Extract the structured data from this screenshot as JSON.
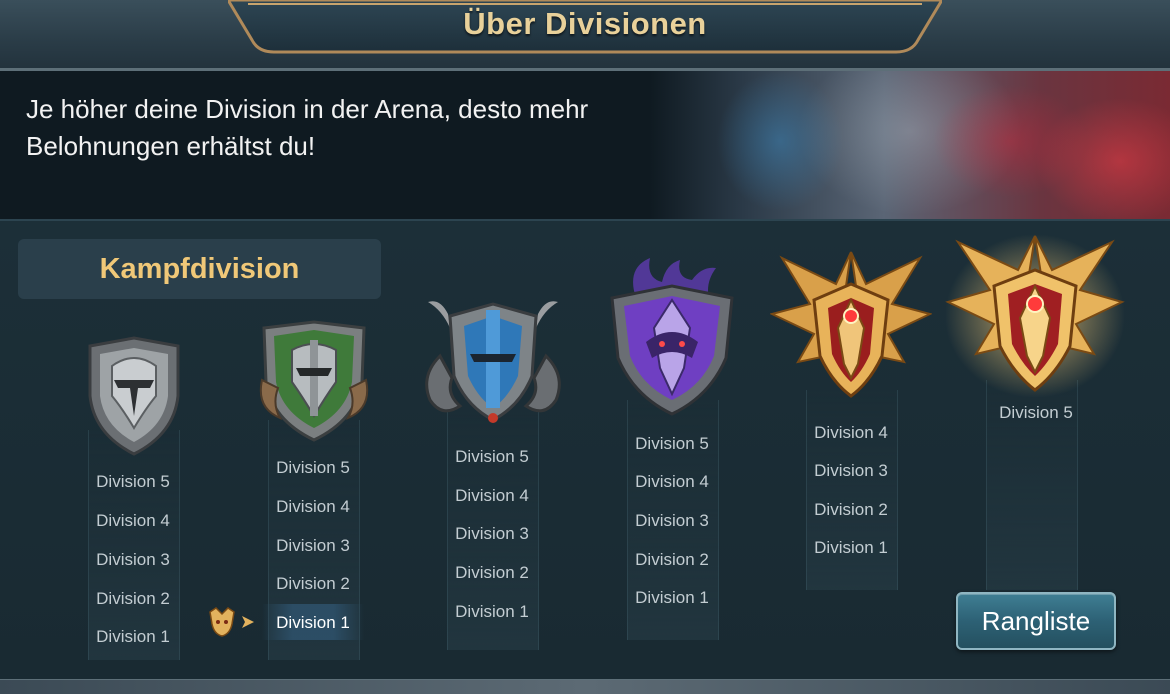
{
  "header": {
    "title": "Über Divisionen"
  },
  "intro": {
    "text": "Je höher deine Division in der Arena, desto mehr Belohnungen erhältst du!"
  },
  "section": {
    "label": "Kampfdivision"
  },
  "tiers": [
    {
      "emblem": "iron-shield-emblem",
      "divisions": [
        "Division 5",
        "Division 4",
        "Division 3",
        "Division 2",
        "Division 1"
      ]
    },
    {
      "emblem": "green-horned-helm-emblem",
      "divisions": [
        "Division 5",
        "Division 4",
        "Division 3",
        "Division 2",
        "Division 1"
      ],
      "current": "Division 1"
    },
    {
      "emblem": "blue-ram-helm-emblem",
      "divisions": [
        "Division 5",
        "Division 4",
        "Division 3",
        "Division 2",
        "Division 1"
      ]
    },
    {
      "emblem": "purple-flame-crest-emblem",
      "divisions": [
        "Division 5",
        "Division 4",
        "Division 3",
        "Division 2",
        "Division 1"
      ]
    },
    {
      "emblem": "gold-winged-crest-emblem",
      "divisions": [
        "Division 4",
        "Division 3",
        "Division 2",
        "Division 1"
      ]
    },
    {
      "emblem": "radiant-gold-crest-emblem",
      "divisions": [
        "Division 5"
      ]
    }
  ],
  "rank_button": {
    "label": "Rangliste"
  },
  "colors": {
    "gold_text": "#f0c878",
    "title_gold": "#e9d19a",
    "button": "#2d6175"
  }
}
